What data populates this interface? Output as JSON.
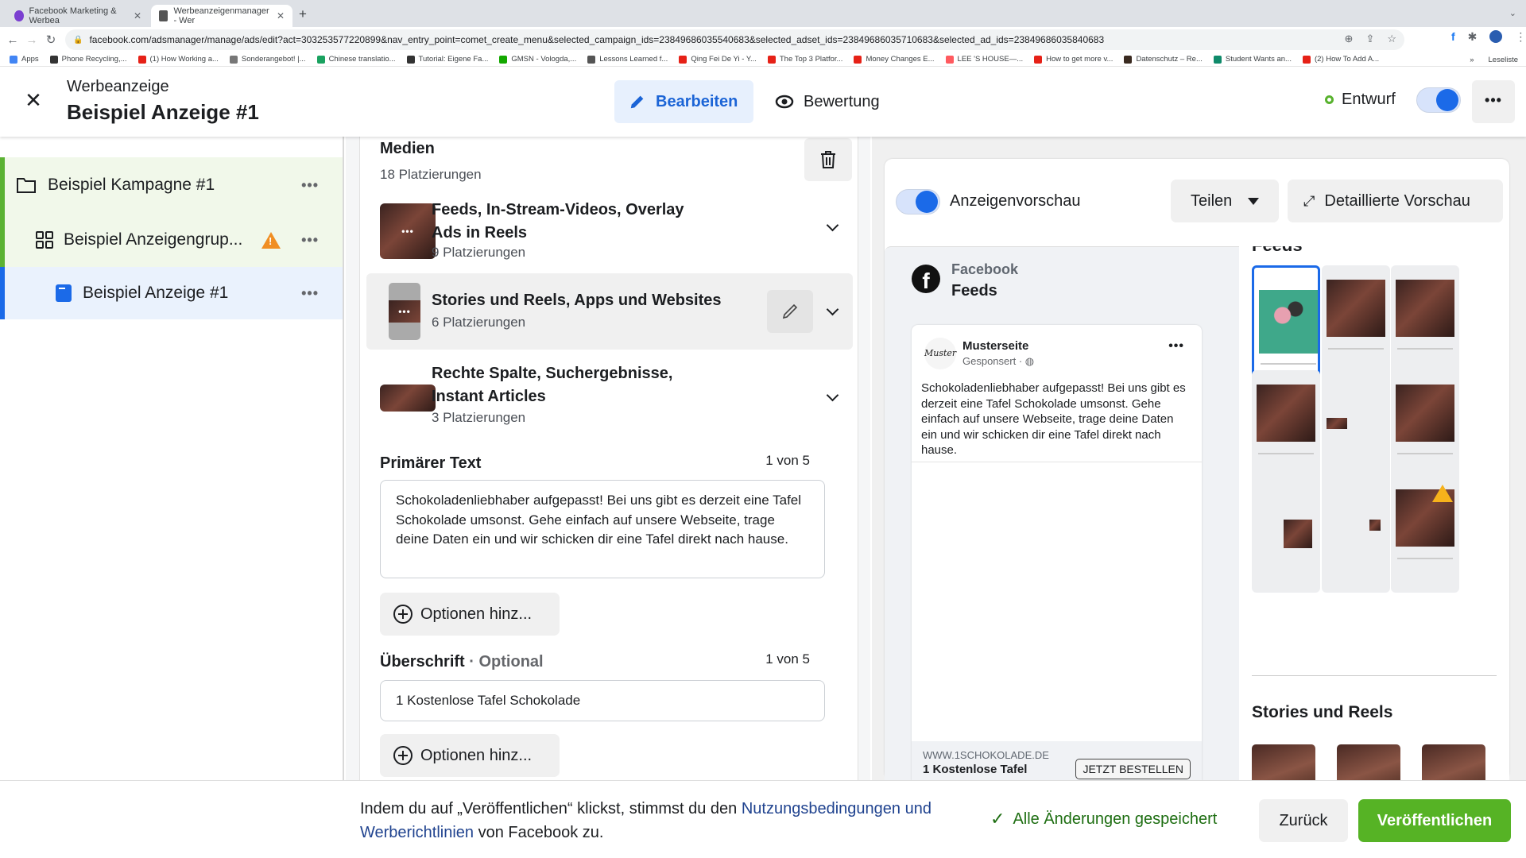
{
  "browser": {
    "tabs": [
      {
        "title": "Facebook Marketing & Werbea",
        "active": false,
        "favicon_color": "#7b3fd1"
      },
      {
        "title": "Werbeanzeigenmanager - Wer",
        "active": true,
        "favicon_color": "#555555"
      }
    ],
    "new_tab": "+",
    "url": "facebook.com/adsmanager/manage/ads/edit?act=303253577220899&nav_entry_point=comet_create_menu&selected_campaign_ids=23849686035540683&selected_adset_ids=23849686035710683&selected_ad_ids=23849686035840683",
    "bookmarks": [
      {
        "label": "Apps",
        "color": "#4285f4"
      },
      {
        "label": "Phone Recycling,...",
        "color": "#333333"
      },
      {
        "label": "(1) How Working a...",
        "color": "#e62117"
      },
      {
        "label": "Sonderangebot! |...",
        "color": "#777777"
      },
      {
        "label": "Chinese translatio...",
        "color": "#1aa260"
      },
      {
        "label": "Tutorial: Eigene Fa...",
        "color": "#333333"
      },
      {
        "label": "GMSN - Vologda,...",
        "color": "#14a800"
      },
      {
        "label": "Lessons Learned f...",
        "color": "#555555"
      },
      {
        "label": "Qing Fei De Yi - Y...",
        "color": "#e62117"
      },
      {
        "label": "The Top 3 Platfor...",
        "color": "#e62117"
      },
      {
        "label": "Money Changes E...",
        "color": "#e62117"
      },
      {
        "label": "LEE 'S HOUSE—...",
        "color": "#ff5a5f"
      },
      {
        "label": "How to get more v...",
        "color": "#e62117"
      },
      {
        "label": "Datenschutz – Re...",
        "color": "#3a2a20"
      },
      {
        "label": "Student Wants an...",
        "color": "#0f8a6a"
      },
      {
        "label": "(2) How To Add A...",
        "color": "#e62117"
      }
    ],
    "bookmarks_overflow": "»",
    "reading_list": "Leseliste"
  },
  "header": {
    "subtitle": "Werbeanzeige",
    "title": "Beispiel Anzeige #1",
    "edit_label": "Bearbeiten",
    "review_label": "Bewertung",
    "status_label": "Entwurf",
    "status_color": "#58b22e",
    "toggle_on": true,
    "more": "•••"
  },
  "sidebar": {
    "items": [
      {
        "label": "Beispiel Kampagne #1",
        "type": "campaign",
        "more": "•••"
      },
      {
        "label": "Beispiel Anzeigengrup...",
        "type": "adset",
        "warning": true,
        "more": "•••"
      },
      {
        "label": "Beispiel Anzeige #1",
        "type": "ad",
        "selected": true,
        "more": "•••"
      }
    ]
  },
  "media": {
    "title": "Medien",
    "count": "18 Platzierungen",
    "placements": [
      {
        "title_line1": "Feeds, In-Stream-Videos, Overlay",
        "title_line2": "Ads in Reels",
        "count": "9 Platzierungen",
        "thumb_label": "•••"
      },
      {
        "title_line1": "Stories und Reels, Apps und Websites",
        "title_line2": "",
        "count": "6 Platzierungen",
        "thumb_label": "•••",
        "hovered": true
      },
      {
        "title_line1": "Rechte Spalte, Suchergebnisse,",
        "title_line2": "Instant Articles",
        "count": "3 Platzierungen",
        "thumb_label": ""
      }
    ]
  },
  "primary_text": {
    "label": "Primärer Text",
    "counter": "1 von 5",
    "value": "Schokoladenliebhaber aufgepasst! Bei uns gibt es derzeit eine Tafel Schokolade umsonst. Gehe einfach auf unsere Webseite, trage deine Daten ein und wir schicken dir eine Tafel direkt nach hause.",
    "add_options": "Optionen hinz..."
  },
  "headline": {
    "label": "Überschrift",
    "optional": "· Optional",
    "counter": "1 von 5",
    "value": "1 Kostenlose Tafel Schokolade",
    "add_options": "Optionen hinz..."
  },
  "preview": {
    "toggle_label": "Anzeigenvorschau",
    "toggle_on": true,
    "share_label": "Teilen",
    "detail_label": "Detaillierte Vorschau",
    "platform": "Facebook",
    "position": "Feeds",
    "post": {
      "avatar_text": "Muster",
      "page_name": "Musterseite",
      "sponsored": "Gesponsert · ◍",
      "more": "•••",
      "text": "Schokoladenliebhaber aufgepasst! Bei uns gibt es derzeit eine Tafel Schokolade umsonst. Gehe einfach auf unsere Webseite, trage deine Daten ein und wir schicken dir eine Tafel direkt nach hause.",
      "url": "WWW.1SCHOKOLADE.DE",
      "headline": "1 Kostenlose Tafel",
      "cta": "JETZT BESTELLEN"
    },
    "grid_section_cut": "Feeds",
    "grid_selected_index": 0,
    "grid_warning_index": 8,
    "stories_title": "Stories und Reels"
  },
  "footer": {
    "legal_prefix": "Indem du auf „Veröffentlichen“ klickst, stimmst du den ",
    "legal_link": "Nutzungsbedingungen und Werberichtlinien",
    "legal_suffix": " von Facebook zu.",
    "saved_label": "Alle Änderungen gespeichert",
    "back_label": "Zurück",
    "publish_label": "Veröffentlichen",
    "publish_color": "#56b325"
  }
}
